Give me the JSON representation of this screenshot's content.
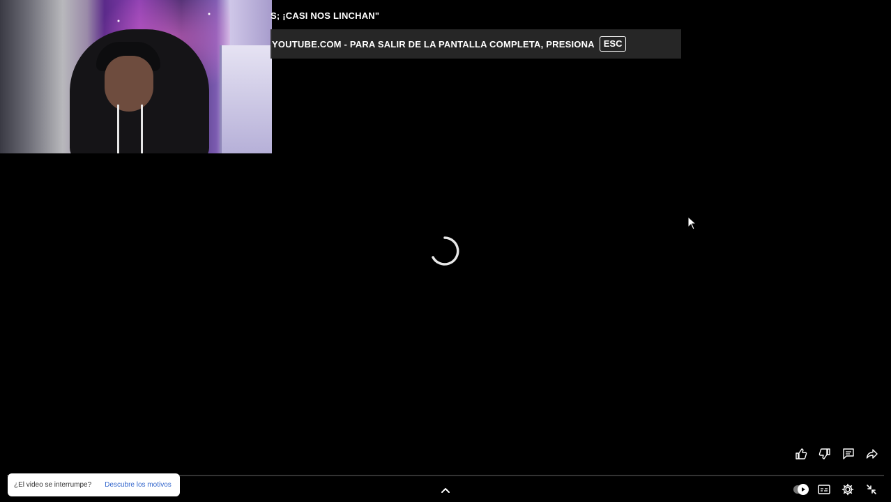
{
  "video": {
    "title": "S; ¡CASI NOS LINCHAN\"",
    "state": "loading"
  },
  "fullscreen_notice": {
    "message": "YOUTUBE.COM - PARA SALIR DE LA PANTALLA COMPLETA, PRESIONA",
    "key": "ESC"
  },
  "interrupt_banner": {
    "question": "¿El video se interrumpe?",
    "link": "Descubre los motivos"
  },
  "actions": [
    "like-icon",
    "dislike-icon",
    "comment-icon",
    "share-icon"
  ],
  "controls": [
    "autoplay-toggle",
    "subtitles-icon",
    "settings-icon",
    "exit-fullscreen-icon"
  ],
  "colors": {
    "background": "#000000",
    "notice_bg": "#282828",
    "link": "#3366cc"
  }
}
